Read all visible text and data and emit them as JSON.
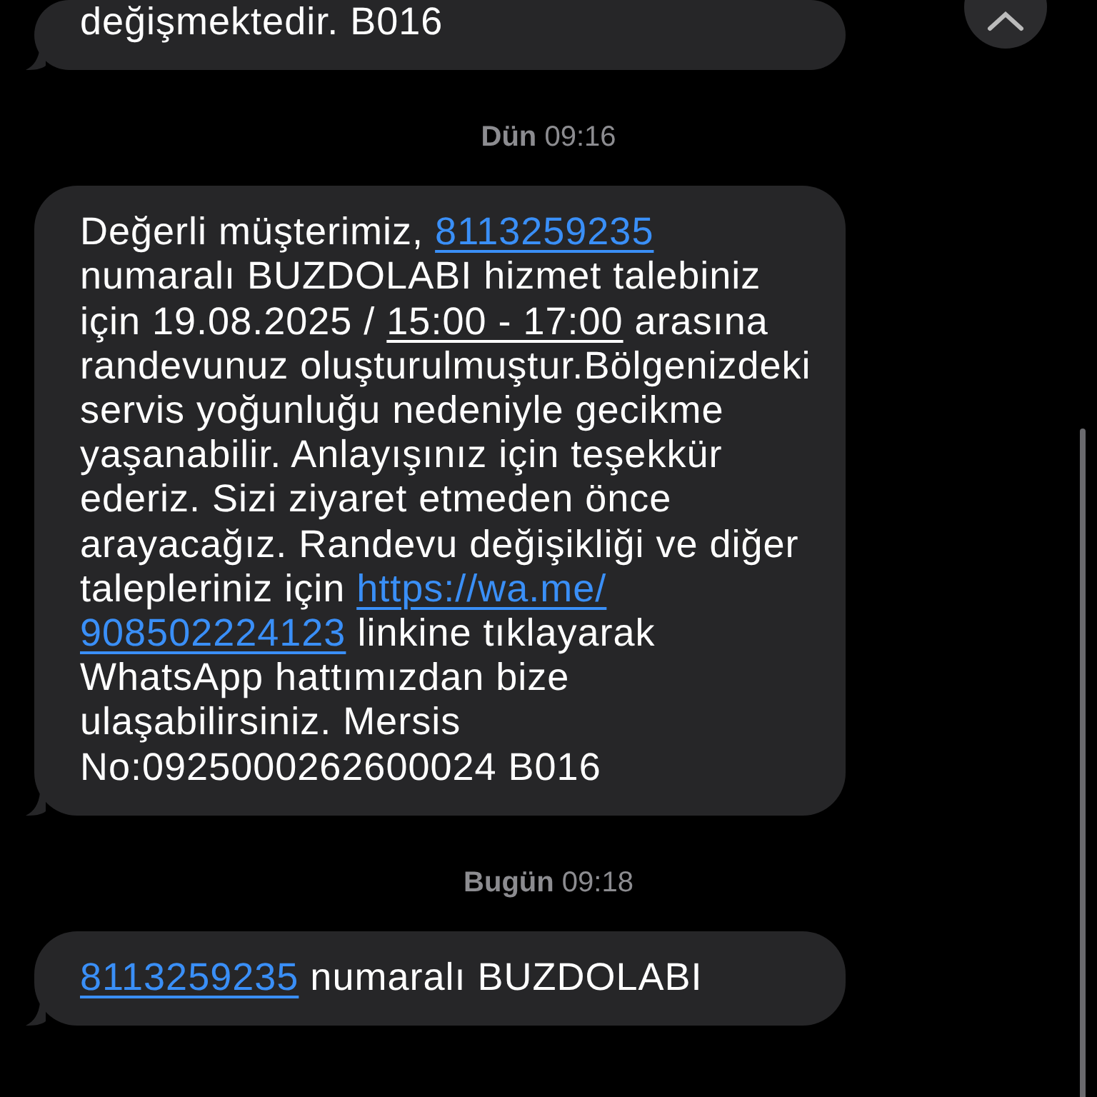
{
  "messages": [
    {
      "kind": "message",
      "segments": [
        {
          "kind": "text",
          "text": "değişmektedir. B016"
        }
      ]
    },
    {
      "kind": "timestamp",
      "text": "**Dün** 09:16"
    },
    {
      "kind": "message",
      "segments": [
        {
          "kind": "text",
          "text": "Değerli müşterimiz, "
        },
        {
          "kind": "link",
          "text": "8113259235"
        },
        {
          "kind": "text",
          "text": " numaralı BUZDOLABI hizmet talebiniz için 19.08.2025 / "
        },
        {
          "kind": "underline",
          "text": "15:00 - 17:00"
        },
        {
          "kind": "text",
          "text": " arasına randevunuz oluşturulmuştur.Bölgenizdeki servis yoğunluğu nedeniyle gecikme yaşanabilir. Anlayışınız için teşekkür ederiz. Sizi ziyaret etmeden önce arayacağız. Randevu değişikliği ve diğer talepleriniz için "
        },
        {
          "kind": "link",
          "text": "https://wa.me/"
        },
        {
          "kind": "link",
          "text": "908502224123"
        },
        {
          "kind": "text",
          "text": " linkine tıklayarak WhatsApp hattımızdan bize ulaşabilirsiniz. Mersis No:0925000262600024 B016"
        }
      ]
    },
    {
      "kind": "timestamp",
      "text": "**Bugün** 09:18"
    },
    {
      "kind": "message",
      "segments": [
        {
          "kind": "link",
          "text": "8113259235"
        },
        {
          "kind": "text",
          "text": " numaralı BUZDOLABI"
        }
      ]
    }
  ]
}
